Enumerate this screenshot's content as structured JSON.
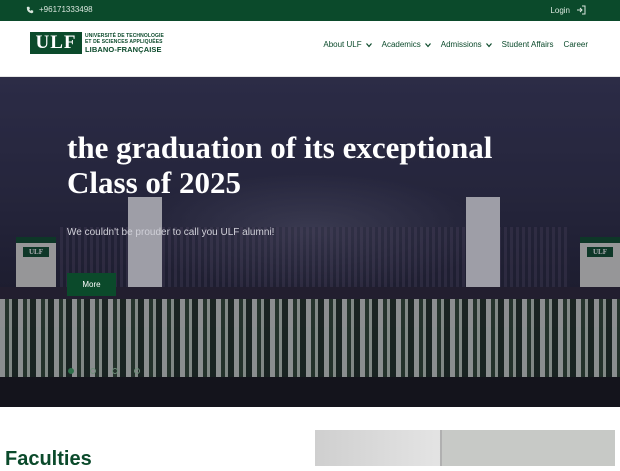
{
  "topbar": {
    "phone": "+96171333498",
    "login": "Login"
  },
  "logo": {
    "mark": "ULF",
    "line1": "UNIVERSITÉ DE TECHNOLOGIE",
    "line2": "ET DE SCIENCES APPLIQUÉES",
    "line3": "LIBANO-FRANÇAISE"
  },
  "nav": [
    {
      "label": "About ULF",
      "has_dropdown": true
    },
    {
      "label": "Academics",
      "has_dropdown": true
    },
    {
      "label": "Admissions",
      "has_dropdown": true
    },
    {
      "label": "Student Affairs",
      "has_dropdown": false
    },
    {
      "label": "Career",
      "has_dropdown": false
    }
  ],
  "hero": {
    "title_line1": "the graduation of its exceptional",
    "title_line2": "Class of 2025",
    "subtitle": "We couldn't be prouder to call you ULF alumni!",
    "button": "More",
    "podium_label": "ULF",
    "slide_count": 4,
    "active_slide": 1
  },
  "section": {
    "heading": "Faculties"
  },
  "colors": {
    "brand_green": "#0b4a2b",
    "white": "#ffffff"
  },
  "icons": {
    "phone": "phone-icon",
    "login": "login-arrow-icon",
    "dropdown": "chevron-down-icon"
  }
}
